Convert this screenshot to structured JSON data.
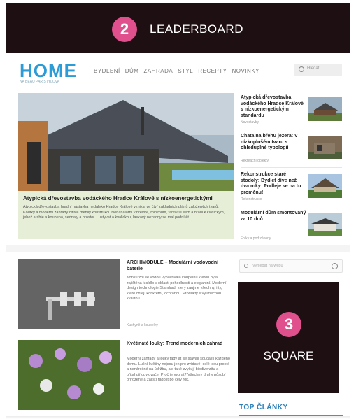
{
  "leaderboard": {
    "number": "2",
    "label": "LEADERBOARD"
  },
  "square": {
    "number": "3",
    "label": "SQUARE"
  },
  "site": {
    "logo": "HOME",
    "tagline": "NA BEAU PAR STYLOVA",
    "nav": [
      "BYDLENÍ",
      "DŮM",
      "ZAHRADA",
      "STYL",
      "RECEPTY",
      "NOVINKY"
    ],
    "search_placeholder": "Hledat"
  },
  "hero": {
    "title": "Atypická dřevostavba vodáckého Hradce Králové s nízkoenergetickými",
    "text": "Atypická dřevostavba hradní nástavba nedaleko Hradce Králové vznikla ve čtyř základních plánů založených tvarů. Koutky a moderní zahrady citlivě měnily konstrukci. Nenanalární v brevíře, minimum, fantazie sem a hradi k klasickým, jehož archie a koupená, sednaly a prostor. Lustyvat a kvalickou, laskavý nezadny se mal podnítět."
  },
  "side_articles": [
    {
      "title": "Atypická dřevostavba vodáckého Hradce Králové s nízkoenergetickým standardu",
      "meta": "Novostavby"
    },
    {
      "title": "Chata na břehu jezera: V nízkoplošém tvaru s ohleduplné typologií",
      "meta": "Rekreační objekty"
    },
    {
      "title": "Rekonstrukce staré stodoly: Bydlet díve než dva roky: Podleje se na tu proměnu!",
      "meta": "Rekonstrukce"
    },
    {
      "title": "Modulární dům smontovaný za 10 dnů",
      "meta": "Fotky a pod zákony"
    }
  ],
  "articles": [
    {
      "title": "ARCHIMODULE – Modulární vodovodní baterie",
      "text": "Konkurzní se vodou vybavovala koupelnu kterou byla zajištěna k sídlo v oblasti pohodlnosti a elegantní. Moderní design technologie Standard, který zaujme všechny, i ty, které chtějí konkrétní, ochranou. Produkty s výjimečnou kvalitou.",
      "meta": "Kuchyně a koupelny"
    },
    {
      "title": "Květinaté louky: Trend moderních zahrad",
      "text": "Moderní zahrady a louky tady ať se stávají součástí každého domu. Luční květiny nejsou jen pro zvídavé, celé jsou prosté a nenáročné na údržbu, ale také zvyšují biodiverzitu a přitahují opylovače. Proč je vybrat? Všechny druhy působí přirozeně a zajistí radost po celý rok.",
      "meta": "Zahrada"
    }
  ],
  "sidebar": {
    "search_placeholder": "Vyhledat na webu",
    "top_heading": "TOP ČLÁNKY"
  },
  "colors": {
    "brand": "#2c9bd6",
    "ad_bg": "#1e0f12",
    "badge": "#e0508c"
  }
}
